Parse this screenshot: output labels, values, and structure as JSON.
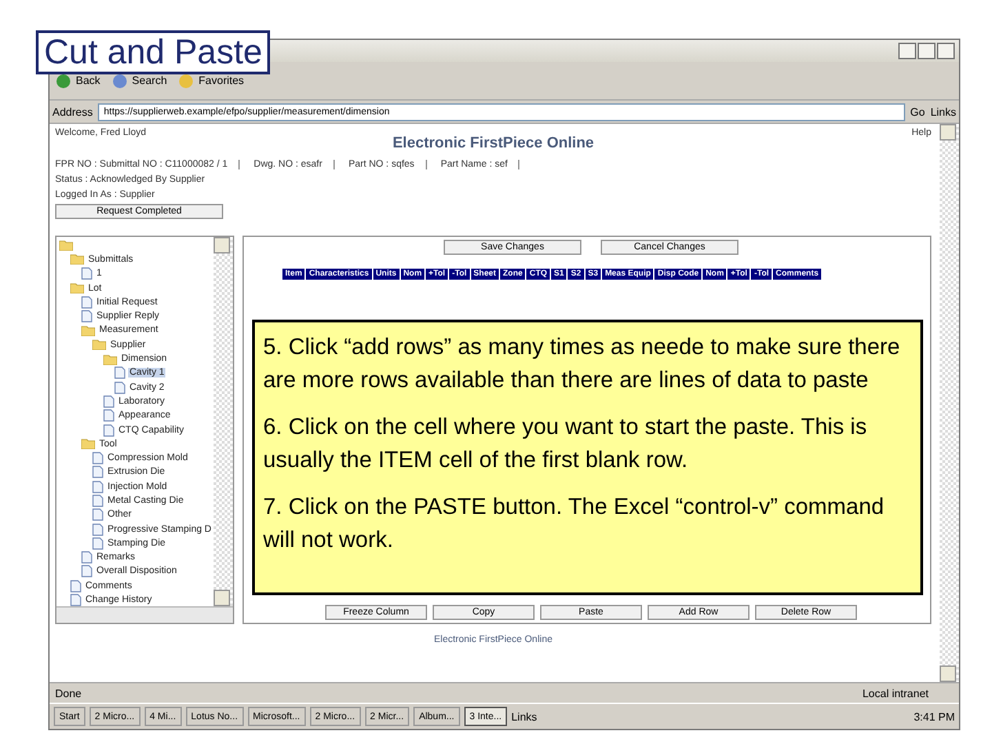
{
  "slide_title": "Cut and Paste",
  "browser": {
    "toolbar": [
      "Back",
      "Search",
      "Favorites"
    ],
    "address_label": "Address",
    "address": "https://supplierweb.example/efpo/supplier/measurement/dimension",
    "go": "Go",
    "links": "Links"
  },
  "page": {
    "welcome": "Welcome, Fred Lloyd",
    "help": "Help",
    "title": "Electronic FirstPiece Online",
    "info": [
      "FPR NO : Submittal NO : C11000082 / 1",
      "Dwg. NO : esafr",
      "Part NO : sqfes",
      "Part Name : sef"
    ],
    "status": "Status : Acknowledged By Supplier",
    "logged_in": "Logged In As : Supplier",
    "request_button": "Request Completed",
    "footer": "Electronic FirstPiece Online"
  },
  "tree": {
    "items": [
      {
        "kind": "folder",
        "children": [
          {
            "label": "Submittals",
            "kind": "folder",
            "selected": false,
            "children": [
              {
                "label": "1",
                "kind": "doc",
                "selected": false
              }
            ]
          },
          {
            "label": "Lot",
            "kind": "folder",
            "selected": false,
            "children": [
              {
                "label": "Initial Request",
                "kind": "doc",
                "selected": false
              },
              {
                "label": "Supplier Reply",
                "kind": "doc",
                "selected": false
              },
              {
                "label": "Measurement",
                "kind": "folder",
                "selected": false,
                "children": [
                  {
                    "label": "Supplier",
                    "kind": "folder",
                    "selected": false,
                    "children": [
                      {
                        "label": "Dimension",
                        "kind": "folder",
                        "selected": false,
                        "children": [
                          {
                            "label": "Cavity 1",
                            "kind": "doc",
                            "selected": true
                          },
                          {
                            "label": "Cavity 2",
                            "kind": "doc",
                            "selected": false
                          }
                        ]
                      },
                      {
                        "label": "Laboratory",
                        "kind": "doc",
                        "selected": false
                      },
                      {
                        "label": "Appearance",
                        "kind": "doc",
                        "selected": false
                      },
                      {
                        "label": "CTQ Capability",
                        "kind": "doc",
                        "selected": false
                      }
                    ]
                  }
                ]
              },
              {
                "label": "Tool",
                "kind": "folder",
                "selected": false,
                "children": [
                  {
                    "label": "Compression Mold",
                    "kind": "doc",
                    "selected": false
                  },
                  {
                    "label": "Extrusion Die",
                    "kind": "doc",
                    "selected": false
                  },
                  {
                    "label": "Injection Mold",
                    "kind": "doc",
                    "selected": false
                  },
                  {
                    "label": "Metal Casting Die",
                    "kind": "doc",
                    "selected": false
                  },
                  {
                    "label": "Other",
                    "kind": "doc",
                    "selected": false
                  },
                  {
                    "label": "Progressive Stamping D",
                    "kind": "doc",
                    "selected": false
                  },
                  {
                    "label": "Stamping Die",
                    "kind": "doc",
                    "selected": false
                  }
                ]
              },
              {
                "label": "Remarks",
                "kind": "doc",
                "selected": false
              },
              {
                "label": "Overall Disposition",
                "kind": "doc",
                "selected": false
              }
            ]
          },
          {
            "label": "Comments",
            "kind": "doc",
            "selected": false
          },
          {
            "label": "Change History",
            "kind": "doc",
            "selected": false
          }
        ]
      }
    ]
  },
  "grid": {
    "top_buttons": [
      "Save Changes",
      "Cancel Changes"
    ],
    "columns": [
      "Item",
      "Characteristics",
      "Units",
      "Nom",
      "+Tol",
      "-Tol",
      "Sheet",
      "Zone",
      "CTQ",
      "S1",
      "S2",
      "S3",
      "Meas Equip",
      "Disp Code",
      "Nom",
      "+Tol",
      "-Tol",
      "Comments"
    ],
    "bottom_buttons": [
      "Freeze Column",
      "Copy",
      "Paste",
      "Add Row",
      "Delete Row"
    ]
  },
  "callout": [
    "5. Click “add rows” as many times as neede to make sure there are more rows available than there are lines of data to paste",
    "6. Click on the cell where you want to start the paste.  This is usually the ITEM cell of the first blank row.",
    "7. Click on the PASTE button.  The Excel “control-v” command will not work."
  ],
  "status_bar": {
    "text": "Done",
    "zone": "Local intranet"
  },
  "taskbar": {
    "start": "Start",
    "tasks": [
      {
        "label": "2 Micro...",
        "selected": false
      },
      {
        "label": "4 Mi...",
        "selected": false
      },
      {
        "label": "Lotus No...",
        "selected": false
      },
      {
        "label": "Microsoft...",
        "selected": false
      },
      {
        "label": "2 Micro...",
        "selected": false
      },
      {
        "label": "2 Micr...",
        "selected": false
      },
      {
        "label": "Album...",
        "selected": false
      },
      {
        "label": "3 Inte...",
        "selected": true
      }
    ],
    "links": "Links",
    "clock": "3:41 PM"
  }
}
